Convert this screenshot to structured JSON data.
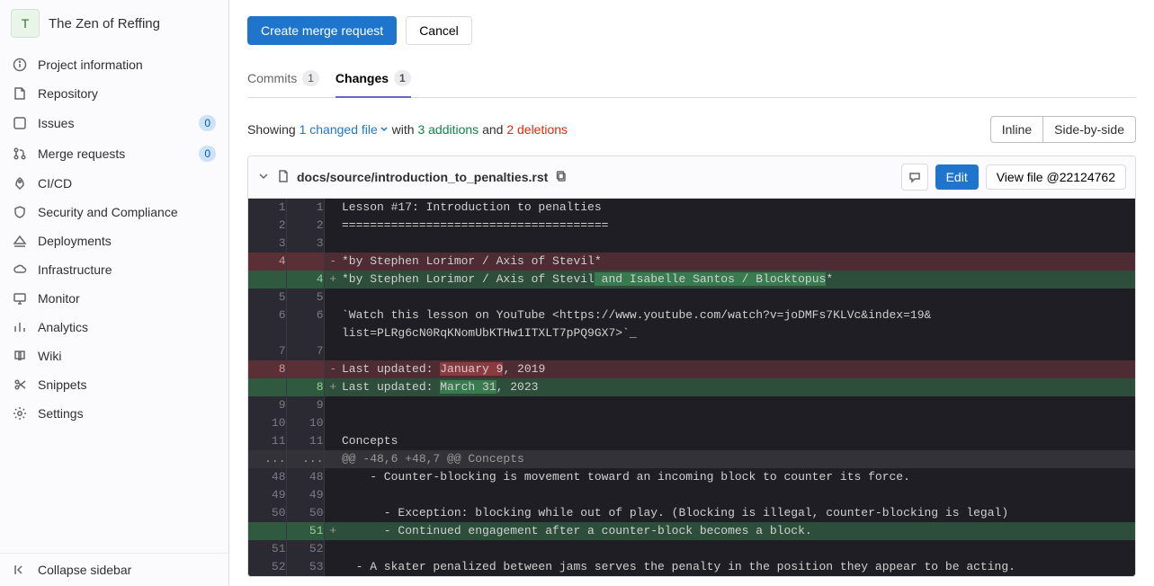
{
  "project": {
    "avatar_letter": "T",
    "name": "The Zen of Reffing"
  },
  "sidebar": {
    "items": [
      {
        "label": "Project information"
      },
      {
        "label": "Repository"
      },
      {
        "label": "Issues",
        "badge": "0",
        "badge_blue": true
      },
      {
        "label": "Merge requests",
        "badge": "0",
        "badge_blue": true
      },
      {
        "label": "CI/CD"
      },
      {
        "label": "Security and Compliance"
      },
      {
        "label": "Deployments"
      },
      {
        "label": "Infrastructure"
      },
      {
        "label": "Monitor"
      },
      {
        "label": "Analytics"
      },
      {
        "label": "Wiki"
      },
      {
        "label": "Snippets"
      },
      {
        "label": "Settings"
      }
    ],
    "collapse_label": "Collapse sidebar"
  },
  "actions": {
    "create_mr": "Create merge request",
    "cancel": "Cancel"
  },
  "tabs": {
    "commits": {
      "label": "Commits",
      "count": "1"
    },
    "changes": {
      "label": "Changes",
      "count": "1"
    }
  },
  "summary": {
    "showing": "Showing ",
    "changed": "1 changed file",
    "with": " with ",
    "additions": "3 additions",
    "and": " and ",
    "deletions": "2 deletions"
  },
  "view_toggle": {
    "inline": "Inline",
    "sbs": "Side-by-side"
  },
  "file": {
    "path": "docs/source/introduction_to_penalties.rst",
    "edit": "Edit",
    "view": "View file @22124762"
  },
  "diff": {
    "rows": [
      {
        "t": "ctx",
        "a": "1",
        "b": "1",
        "code": "Lesson #17: Introduction to penalties"
      },
      {
        "t": "ctx",
        "a": "2",
        "b": "2",
        "code": "======================================"
      },
      {
        "t": "ctx",
        "a": "3",
        "b": "3",
        "code": ""
      },
      {
        "t": "del",
        "a": "4",
        "b": "",
        "code": "*by Stephen Lorimor / Axis of Stevil",
        "tail": "*"
      },
      {
        "t": "add",
        "a": "",
        "b": "4",
        "code": "*by Stephen Lorimor / Axis of Stevil",
        "hl": " and Isabelle Santos / Blocktopus",
        "tail": "*"
      },
      {
        "t": "ctx",
        "a": "5",
        "b": "5",
        "code": ""
      },
      {
        "t": "ctx",
        "a": "6",
        "b": "6",
        "code": "`Watch this lesson on YouTube <https://www.youtube.com/watch?v=joDMFs7KLVc&index=19&"
      },
      {
        "t": "wrap",
        "a": "",
        "b": "",
        "code": "list=PLRg6cN0RqKNomUbKTHw1ITXLT7pPQ9GX7>`_"
      },
      {
        "t": "ctx",
        "a": "7",
        "b": "7",
        "code": ""
      },
      {
        "t": "del",
        "a": "8",
        "b": "",
        "code": "Last updated: ",
        "hl": "January 9",
        ", ": "",
        "tail": ", 2019"
      },
      {
        "t": "add",
        "a": "",
        "b": "8",
        "code": "Last updated: ",
        "hl": "March 31",
        "tail": ", 2023"
      },
      {
        "t": "ctx",
        "a": "9",
        "b": "9",
        "code": ""
      },
      {
        "t": "ctx",
        "a": "10",
        "b": "10",
        "code": ""
      },
      {
        "t": "ctx",
        "a": "11",
        "b": "11",
        "code": "Concepts"
      },
      {
        "t": "hunk",
        "a": "...",
        "b": "...",
        "code": "@@ -48,6 +48,7 @@ Concepts"
      },
      {
        "t": "ctx",
        "a": "48",
        "b": "48",
        "code": "    - Counter-blocking is movement toward an incoming block to counter its force."
      },
      {
        "t": "ctx",
        "a": "49",
        "b": "49",
        "code": ""
      },
      {
        "t": "ctx",
        "a": "50",
        "b": "50",
        "code": "      - Exception: blocking while out of play. (Blocking is illegal, counter-blocking is legal)"
      },
      {
        "t": "add",
        "a": "",
        "b": "51",
        "code": "      - Continued engagement after a counter-block becomes a block."
      },
      {
        "t": "ctx",
        "a": "51",
        "b": "52",
        "code": ""
      },
      {
        "t": "ctx",
        "a": "52",
        "b": "53",
        "code": "  - A skater penalized between jams serves the penalty in the position they appear to be acting."
      }
    ]
  }
}
